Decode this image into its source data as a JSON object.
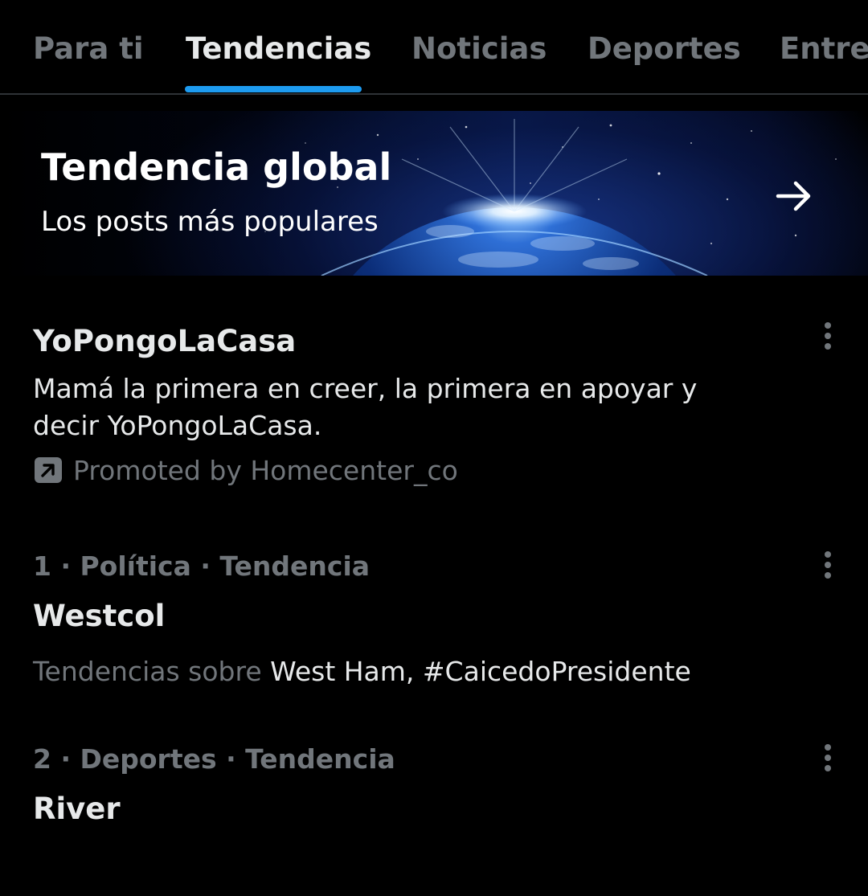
{
  "tabs": [
    {
      "label": "Para ti",
      "active": false
    },
    {
      "label": "Tendencias",
      "active": true
    },
    {
      "label": "Noticias",
      "active": false
    },
    {
      "label": "Deportes",
      "active": false
    },
    {
      "label": "Entretenimiento",
      "active": false
    }
  ],
  "banner": {
    "title": "Tendencia global",
    "subtitle": "Los posts más populares",
    "icon": "arrow-right-icon"
  },
  "promoted": {
    "name": "YoPongoLaCasa",
    "description": "Mamá la primera en creer, la primera en apoyar y decir YoPongoLaCasa.",
    "promoted_by": "Promoted by Homecenter_co",
    "icon": "promoted-arrow-icon",
    "menu_icon": "more-vertical-icon"
  },
  "trends": [
    {
      "meta": "1 · Política · Tendencia",
      "name": "Westcol",
      "context_lead": "Tendencias sobre",
      "context_topics": "West Ham, #CaicedoPresidente"
    },
    {
      "meta": "2 · Deportes · Tendencia",
      "name": "River"
    }
  ],
  "colors": {
    "background": "#000000",
    "text_primary": "#e7e9ea",
    "text_secondary": "#71767b",
    "accent": "#1d9bf0",
    "divider": "#2f3336"
  }
}
